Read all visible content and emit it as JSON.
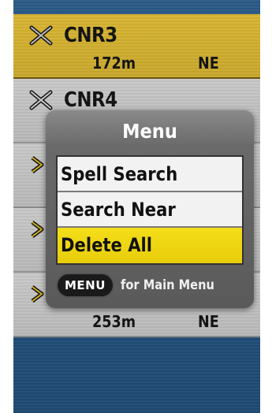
{
  "waypoints": [
    {
      "name": "CNR3",
      "distance": "172m",
      "direction": "NE",
      "selected": true
    },
    {
      "name": "CNR4",
      "distance": "",
      "direction": "",
      "selected": false
    },
    {
      "name": "",
      "distance": "",
      "direction": "",
      "selected": false
    },
    {
      "name": "",
      "distance": "",
      "direction": "",
      "selected": false
    },
    {
      "name": "",
      "distance": "253m",
      "direction": "NE",
      "selected": false
    }
  ],
  "menu": {
    "title": "Menu",
    "options": [
      "Spell Search",
      "Search Near",
      "Delete All"
    ],
    "highlighted_index": 2,
    "footer_key": "MENU",
    "footer_text": "for Main Menu"
  },
  "colors": {
    "selected_row": "#d8b633",
    "row": "#c9c9c9",
    "highlight": "#f4dd19",
    "background": "#22507a"
  },
  "icons": {
    "waypoint": "crossed-tools-icon"
  }
}
